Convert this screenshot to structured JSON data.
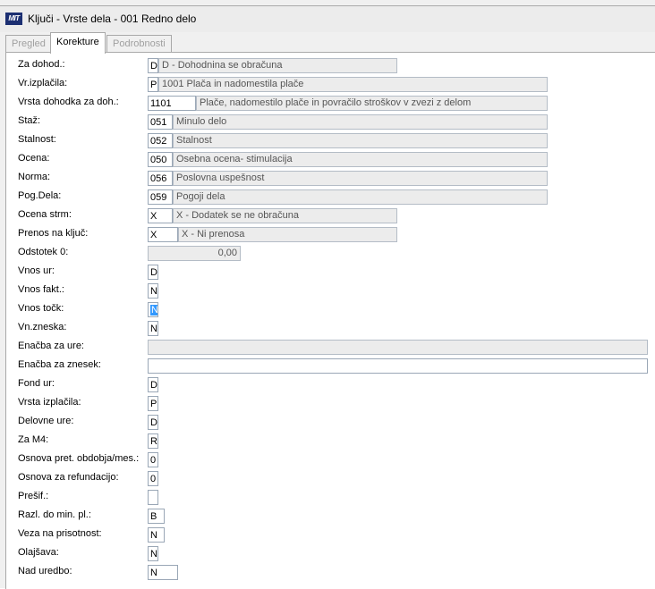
{
  "window": {
    "icon_text": "MIT",
    "title": "Ključi - Vrste dela - 001 Redno delo"
  },
  "tabs": [
    {
      "label": "Pregled",
      "active": false
    },
    {
      "label": "Korekture",
      "active": true
    },
    {
      "label": "Podrobnosti",
      "active": false
    }
  ],
  "fields": [
    {
      "label": "Za dohod.:",
      "code": "D",
      "desc": "D - Dohodnina se obračuna"
    },
    {
      "label": "Vr.izplačila:",
      "code": "P",
      "desc": "1001  Plača in nadomestila plače"
    },
    {
      "label": "Vrsta dohodka za doh.:",
      "code": "1101",
      "desc": "Plače, nadomestilo plače in povračilo stroškov v zvezi z delom"
    },
    {
      "label": "Staž:",
      "code": "051",
      "desc": "Minulo delo"
    },
    {
      "label": "Stalnost:",
      "code": "052",
      "desc": "Stalnost"
    },
    {
      "label": "Ocena:",
      "code": "050",
      "desc": "Osebna ocena- stimulacija"
    },
    {
      "label": "Norma:",
      "code": "056",
      "desc": "Poslovna uspešnost"
    },
    {
      "label": "Pog.Dela:",
      "code": "059",
      "desc": "Pogoji dela"
    },
    {
      "label": "Ocena strm:",
      "code": "X",
      "desc": "X - Dodatek se ne obračuna"
    },
    {
      "label": "Prenos na ključ:",
      "code": "X",
      "desc": "X - Ni prenosa"
    },
    {
      "label": "Odstotek 0:",
      "value": "0,00"
    },
    {
      "label": "Vnos ur:",
      "code": "D"
    },
    {
      "label": "Vnos fakt.:",
      "code": "N"
    },
    {
      "label": "Vnos točk:",
      "code": "N",
      "selected": true
    },
    {
      "label": "Vn.zneska:",
      "code": "N"
    },
    {
      "label": "Enačba za ure:",
      "value": ""
    },
    {
      "label": "Enačba za znesek:",
      "value": ""
    },
    {
      "label": "Fond ur:",
      "code": "D"
    },
    {
      "label": "Vrsta izplačila:",
      "code": "P"
    },
    {
      "label": "Delovne ure:",
      "code": "D"
    },
    {
      "label": "Za M4:",
      "code": "R"
    },
    {
      "label": "Osnova pret. obdobja/mes.:",
      "code": "0"
    },
    {
      "label": "Osnova za refundacijo:",
      "code": "0"
    },
    {
      "label": "Prešif.:",
      "code": ""
    },
    {
      "label": "Razl. do min. pl.:",
      "code": "B"
    },
    {
      "label": "Veza na prisotnost:",
      "code": "N"
    },
    {
      "label": "Olajšava:",
      "code": "N"
    },
    {
      "label": "Nad uredbo:",
      "code": "N"
    }
  ]
}
